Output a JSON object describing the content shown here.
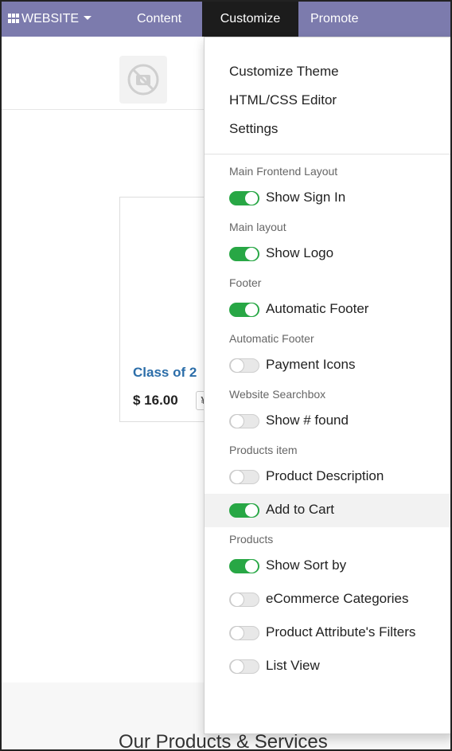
{
  "navbar": {
    "website_label": "WEBSITE",
    "content_label": "Content",
    "customize_label": "Customize",
    "promote_label": "Promote",
    "bg_color": "#7c7bad",
    "active_color": "#1c1c1c"
  },
  "page": {
    "product_name": "Class of 2",
    "product_price": "$ 16.00",
    "cart_glyph": "¥",
    "section_title": "Our Products & Services"
  },
  "menu": {
    "links": [
      "Customize Theme",
      "HTML/CSS Editor",
      "Settings"
    ],
    "groups": [
      {
        "header": "Main Frontend Layout",
        "options": [
          {
            "label": "Show Sign In",
            "on": true
          }
        ]
      },
      {
        "header": "Main layout",
        "options": [
          {
            "label": "Show Logo",
            "on": true
          }
        ]
      },
      {
        "header": "Footer",
        "options": [
          {
            "label": "Automatic Footer",
            "on": true
          }
        ]
      },
      {
        "header": "Automatic Footer",
        "options": [
          {
            "label": "Payment Icons",
            "on": false
          }
        ]
      },
      {
        "header": "Website Searchbox",
        "options": [
          {
            "label": "Show # found",
            "on": false
          }
        ]
      },
      {
        "header": "Products item",
        "options": [
          {
            "label": "Product Description",
            "on": false
          },
          {
            "label": "Add to Cart",
            "on": true
          }
        ]
      },
      {
        "header": "Products",
        "options": [
          {
            "label": "Show Sort by",
            "on": true
          },
          {
            "label": "eCommerce Categories",
            "on": false
          },
          {
            "label": "Product Attribute's Filters",
            "on": false
          },
          {
            "label": "List View",
            "on": false
          }
        ]
      }
    ],
    "toggle_on_color": "#28a745"
  }
}
